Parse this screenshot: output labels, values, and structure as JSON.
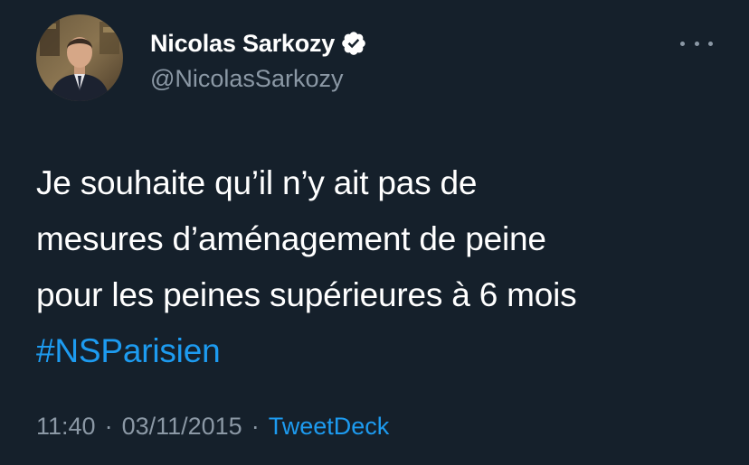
{
  "tweet": {
    "author": {
      "display_name": "Nicolas Sarkozy",
      "handle": "@NicolasSarkozy",
      "verified": true,
      "avatar_icon": "profile-photo"
    },
    "more_icon": "more-horizontal-icon",
    "text_lines": [
      "Je souhaite qu’il n’y ait pas de",
      "mesures d’aménagement de peine",
      "pour les peines supérieures à 6 mois"
    ],
    "hashtag": "#NSParisien",
    "time": "11:40",
    "separator": "·",
    "date": "03/11/2015",
    "source": "TweetDeck"
  },
  "colors": {
    "background": "#15202b",
    "text_primary": "#ffffff",
    "text_secondary": "#8b98a5",
    "accent": "#1d9bf0"
  }
}
